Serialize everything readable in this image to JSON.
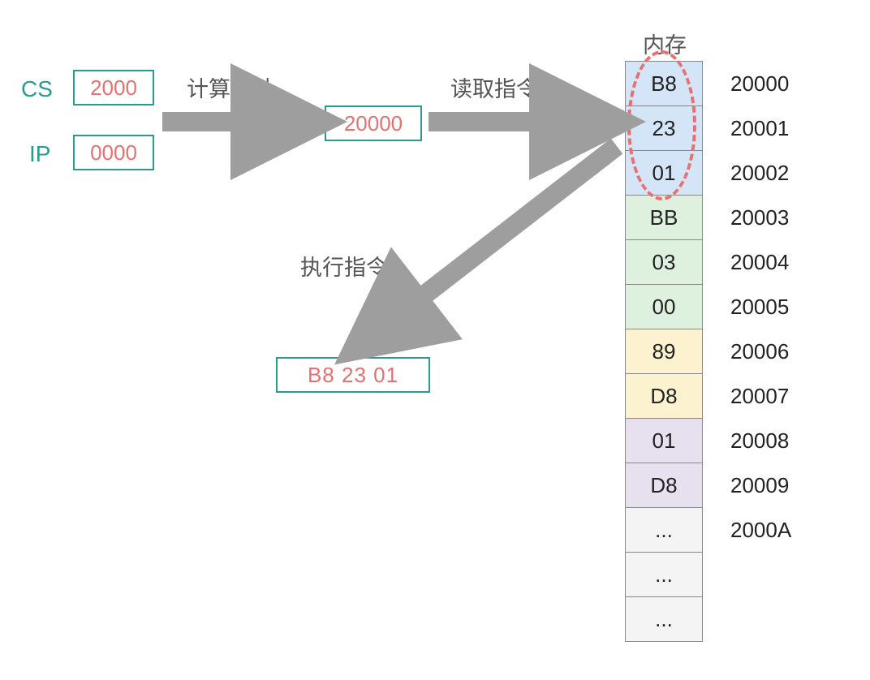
{
  "registers": {
    "cs": {
      "label": "CS",
      "value": "2000"
    },
    "ip": {
      "label": "IP",
      "value": "0000"
    }
  },
  "steps": {
    "compute_address": "计算地址",
    "read_instruction": "读取指令",
    "execute_instruction": "执行指令"
  },
  "computed_address": "20000",
  "fetched_instruction": "B8 23 01",
  "memory": {
    "title": "内存",
    "cells": [
      {
        "value": "B8",
        "address": "20000",
        "bg": "bg-blue"
      },
      {
        "value": "23",
        "address": "20001",
        "bg": "bg-blue"
      },
      {
        "value": "01",
        "address": "20002",
        "bg": "bg-blue"
      },
      {
        "value": "BB",
        "address": "20003",
        "bg": "bg-green"
      },
      {
        "value": "03",
        "address": "20004",
        "bg": "bg-green"
      },
      {
        "value": "00",
        "address": "20005",
        "bg": "bg-green"
      },
      {
        "value": "89",
        "address": "20006",
        "bg": "bg-yellow"
      },
      {
        "value": "D8",
        "address": "20007",
        "bg": "bg-yellow"
      },
      {
        "value": "01",
        "address": "20008",
        "bg": "bg-purple"
      },
      {
        "value": "D8",
        "address": "20009",
        "bg": "bg-purple"
      },
      {
        "value": "...",
        "address": "2000A",
        "bg": "bg-gray"
      },
      {
        "value": "...",
        "address": "",
        "bg": "bg-gray"
      },
      {
        "value": "...",
        "address": "",
        "bg": "bg-gray"
      }
    ]
  }
}
